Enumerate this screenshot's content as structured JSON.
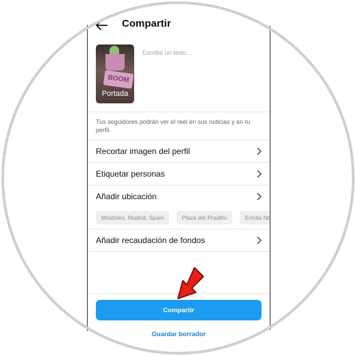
{
  "header": {
    "back_icon": "arrow-left-icon",
    "title": "Compartir"
  },
  "composer": {
    "cover_label": "Portada",
    "caption_placeholder": "Escribe un texto...",
    "caption_value": "",
    "notice": "Tus seguidores podrán ver el reel en sus noticias y en tu perfil."
  },
  "options": [
    {
      "label": "Recortar imagen del perfil"
    },
    {
      "label": "Etiquetar personas"
    },
    {
      "label": "Añadir ubicación"
    },
    {
      "label": "Añadir recaudación de fondos"
    }
  ],
  "location_suggestions": [
    "Móstoles, Madrid, Spain",
    "Plaza del Pradillo",
    "Ermita Ntra"
  ],
  "actions": {
    "share_label": "Compartir",
    "draft_label": "Guardar borrador"
  },
  "colors": {
    "accent": "#1d9bf0",
    "link": "#1d7fd6",
    "annotation_arrow": "#e8201a"
  }
}
